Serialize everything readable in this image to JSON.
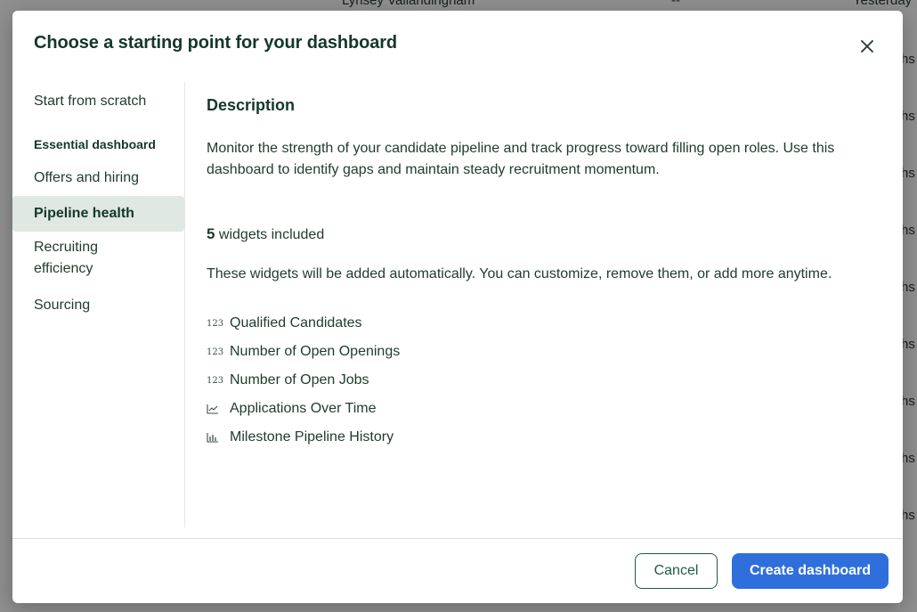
{
  "background": {
    "row": {
      "name": "Lynsey Vallandingham",
      "dash": "--",
      "date": "Yesterday"
    },
    "fragments": [
      "hs",
      "hs",
      "hs",
      "hs",
      "hs",
      "hs",
      "hs",
      "hs",
      "hs"
    ]
  },
  "modal": {
    "title": "Choose a starting point for your dashboard",
    "sidebar": {
      "start": "Start from scratch",
      "section": "Essential dashboard",
      "items": [
        "Offers and hiring",
        "Pipeline health",
        "Recruiting efficiency",
        "Sourcing"
      ],
      "active_index": 1
    },
    "content": {
      "heading": "Description",
      "description": "Monitor the strength of your candidate pipeline and track progress toward filling open roles. Use this dashboard to identify gaps and maintain steady recruitment momentum.",
      "widget_count": "5",
      "widget_count_suffix": " widgets included",
      "auto_note": "These widgets will be added automatically. You can customize, remove them, or add more anytime.",
      "widgets": [
        {
          "icon": "number-icon",
          "glyph": "123",
          "label": "Qualified Candidates"
        },
        {
          "icon": "number-icon",
          "glyph": "123",
          "label": "Number of Open Openings"
        },
        {
          "icon": "number-icon",
          "glyph": "123",
          "label": "Number of Open Jobs"
        },
        {
          "icon": "line-chart-icon",
          "glyph": "",
          "label": "Applications Over Time"
        },
        {
          "icon": "bar-chart-icon",
          "glyph": "",
          "label": "Milestone Pipeline History"
        }
      ]
    },
    "footer": {
      "cancel": "Cancel",
      "create": "Create dashboard"
    }
  },
  "colors": {
    "primary": "#2f6fdc",
    "active_bg": "#dfe8e3",
    "text": "#1f3b2c",
    "outline": "#1f5a44"
  }
}
